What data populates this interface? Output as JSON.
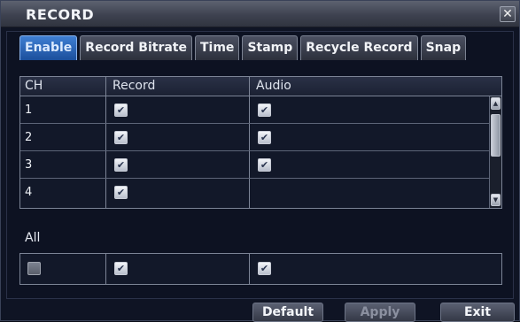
{
  "window": {
    "title": "RECORD",
    "close_glyph": "✕"
  },
  "tabs": [
    {
      "label": "Enable",
      "active": true
    },
    {
      "label": "Record Bitrate",
      "active": false
    },
    {
      "label": "Time",
      "active": false
    },
    {
      "label": "Stamp",
      "active": false
    },
    {
      "label": "Recycle Record",
      "active": false
    },
    {
      "label": "Snap",
      "active": false
    }
  ],
  "table": {
    "columns": {
      "ch": "CH",
      "record": "Record",
      "audio": "Audio"
    },
    "rows": [
      {
        "ch": "1",
        "record": true,
        "audio": true
      },
      {
        "ch": "2",
        "record": true,
        "audio": true
      },
      {
        "ch": "3",
        "record": true,
        "audio": true
      },
      {
        "ch": "4",
        "record": true,
        "audio": false
      }
    ]
  },
  "all": {
    "label": "All",
    "enable": false,
    "record": true,
    "audio": true
  },
  "buttons": {
    "default": "Default",
    "apply": "Apply",
    "exit": "Exit"
  },
  "check_glyph": "✔",
  "scroll_up_glyph": "▲",
  "scroll_down_glyph": "▼",
  "colors": {
    "active_tab": "#2a62b8",
    "background": "#0f1424"
  }
}
